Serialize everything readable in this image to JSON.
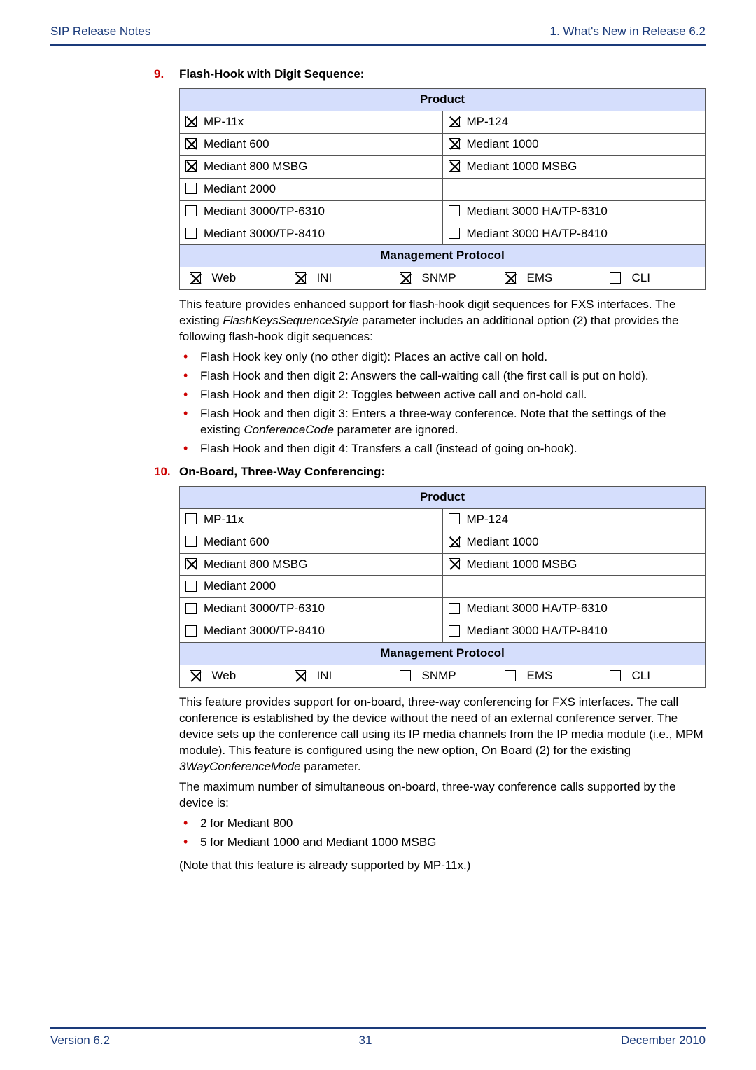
{
  "header": {
    "left": "SIP Release Notes",
    "right": "1. What's New in Release 6.2"
  },
  "items": [
    {
      "num": "9.",
      "title": "Flash-Hook with Digit Sequence:",
      "product_header": "Product",
      "rows": [
        [
          {
            "checked": true,
            "label": "MP-11x"
          },
          {
            "checked": true,
            "label": "MP-124"
          }
        ],
        [
          {
            "checked": true,
            "label": "Mediant 600"
          },
          {
            "checked": true,
            "label": "Mediant 1000"
          }
        ],
        [
          {
            "checked": true,
            "label": "Mediant 800 MSBG"
          },
          {
            "checked": true,
            "label": "Mediant 1000 MSBG"
          }
        ],
        [
          {
            "checked": false,
            "label": "Mediant 2000"
          },
          null
        ],
        [
          {
            "checked": false,
            "label": "Mediant 3000/TP-6310"
          },
          {
            "checked": false,
            "label": "Mediant 3000 HA/TP-6310"
          }
        ],
        [
          {
            "checked": false,
            "label": "Mediant 3000/TP-8410"
          },
          {
            "checked": false,
            "label": "Mediant 3000 HA/TP-8410"
          }
        ]
      ],
      "mgmt_header": "Management Protocol",
      "mgmt": [
        {
          "checked": true,
          "label": "Web"
        },
        {
          "checked": true,
          "label": "INI"
        },
        {
          "checked": true,
          "label": "SNMP"
        },
        {
          "checked": true,
          "label": "EMS"
        },
        {
          "checked": false,
          "label": "CLI"
        }
      ],
      "body_pre": "This feature provides enhanced support for flash-hook digit sequences for FXS interfaces. The existing ",
      "body_em": "FlashKeysSequenceStyle",
      "body_post": " parameter includes an additional option (2) that provides the following flash-hook digit sequences:",
      "bullets": [
        "Flash Hook key only (no other digit): Places an active call on hold.",
        "Flash Hook and then digit 2: Answers the call-waiting call (the first call is put on hold).",
        "Flash Hook and then digit 2: Toggles between active call and on-hold call.",
        {
          "pre": "Flash Hook and then digit 3: Enters a three-way conference. Note that the settings of the existing ",
          "em": "ConferenceCode",
          "post": " parameter are ignored."
        },
        "Flash Hook and then digit 4: Transfers a call (instead of going on-hook)."
      ]
    },
    {
      "num": "10.",
      "title": "On-Board, Three-Way Conferencing:",
      "product_header": "Product",
      "rows": [
        [
          {
            "checked": false,
            "label": "MP-11x"
          },
          {
            "checked": false,
            "label": "MP-124"
          }
        ],
        [
          {
            "checked": false,
            "label": "Mediant 600"
          },
          {
            "checked": true,
            "label": "Mediant 1000"
          }
        ],
        [
          {
            "checked": true,
            "label": "Mediant 800 MSBG"
          },
          {
            "checked": true,
            "label": "Mediant 1000 MSBG"
          }
        ],
        [
          {
            "checked": false,
            "label": "Mediant 2000"
          },
          null
        ],
        [
          {
            "checked": false,
            "label": "Mediant 3000/TP-6310"
          },
          {
            "checked": false,
            "label": "Mediant 3000 HA/TP-6310"
          }
        ],
        [
          {
            "checked": false,
            "label": "Mediant 3000/TP-8410"
          },
          {
            "checked": false,
            "label": "Mediant 3000 HA/TP-8410"
          }
        ]
      ],
      "mgmt_header": "Management Protocol",
      "mgmt": [
        {
          "checked": true,
          "label": "Web"
        },
        {
          "checked": true,
          "label": "INI"
        },
        {
          "checked": false,
          "label": "SNMP"
        },
        {
          "checked": false,
          "label": "EMS"
        },
        {
          "checked": false,
          "label": "CLI"
        }
      ],
      "body_pre": "This feature provides support for on-board, three-way conferencing for FXS interfaces. The call conference is established by the device without the need of an external conference server. The device sets up the conference call using its IP media channels from the IP media module (i.e., MPM module). This feature is configured using the new option, On Board (2) for the existing ",
      "body_em": "3WayConferenceMode",
      "body_post": " parameter.",
      "body2": "The maximum number of simultaneous on-board, three-way conference calls supported by the device is:",
      "bullets": [
        "2 for Mediant 800",
        "5 for Mediant 1000 and Mediant 1000 MSBG"
      ],
      "note": "(Note that this feature is already supported by MP-11x.)"
    }
  ],
  "footer": {
    "left": "Version 6.2",
    "center": "31",
    "right": "December 2010"
  }
}
